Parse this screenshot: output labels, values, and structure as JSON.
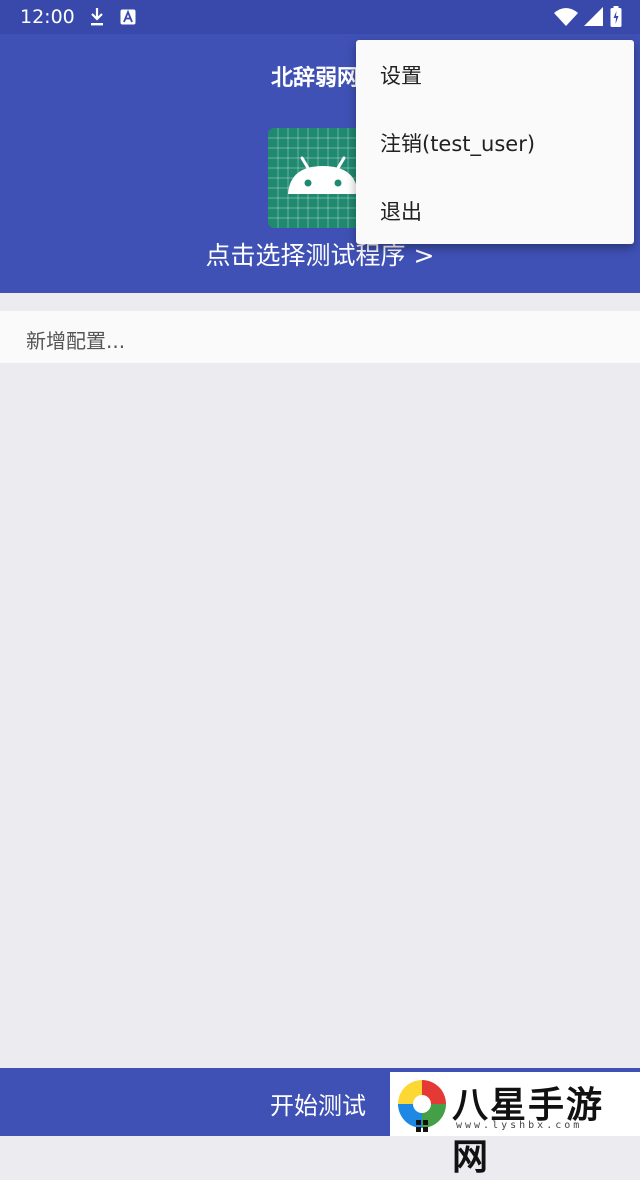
{
  "status_bar": {
    "time": "12:00",
    "left_icons": [
      "download-icon",
      "a-app-icon"
    ],
    "right_icons": [
      "wifi-icon",
      "signal-icon",
      "battery-icon"
    ]
  },
  "header": {
    "title": "北辞弱网",
    "select_program_label": "点击选择测试程序 >"
  },
  "config": {
    "add_label": "新增配置..."
  },
  "bottom": {
    "start_label": "开始测试"
  },
  "overflow_menu": {
    "items": [
      {
        "label": "设置"
      },
      {
        "label": "注销(test_user)"
      },
      {
        "label": "退出"
      }
    ]
  },
  "watermark": {
    "name": "八星手游网",
    "url": "www.lyshbx.com"
  },
  "colors": {
    "primary": "#3f51b5",
    "status_bar": "#3949ab",
    "background": "#ebebf0",
    "app_icon_bg": "#1f8a70",
    "menu_bg": "#fafafa"
  }
}
